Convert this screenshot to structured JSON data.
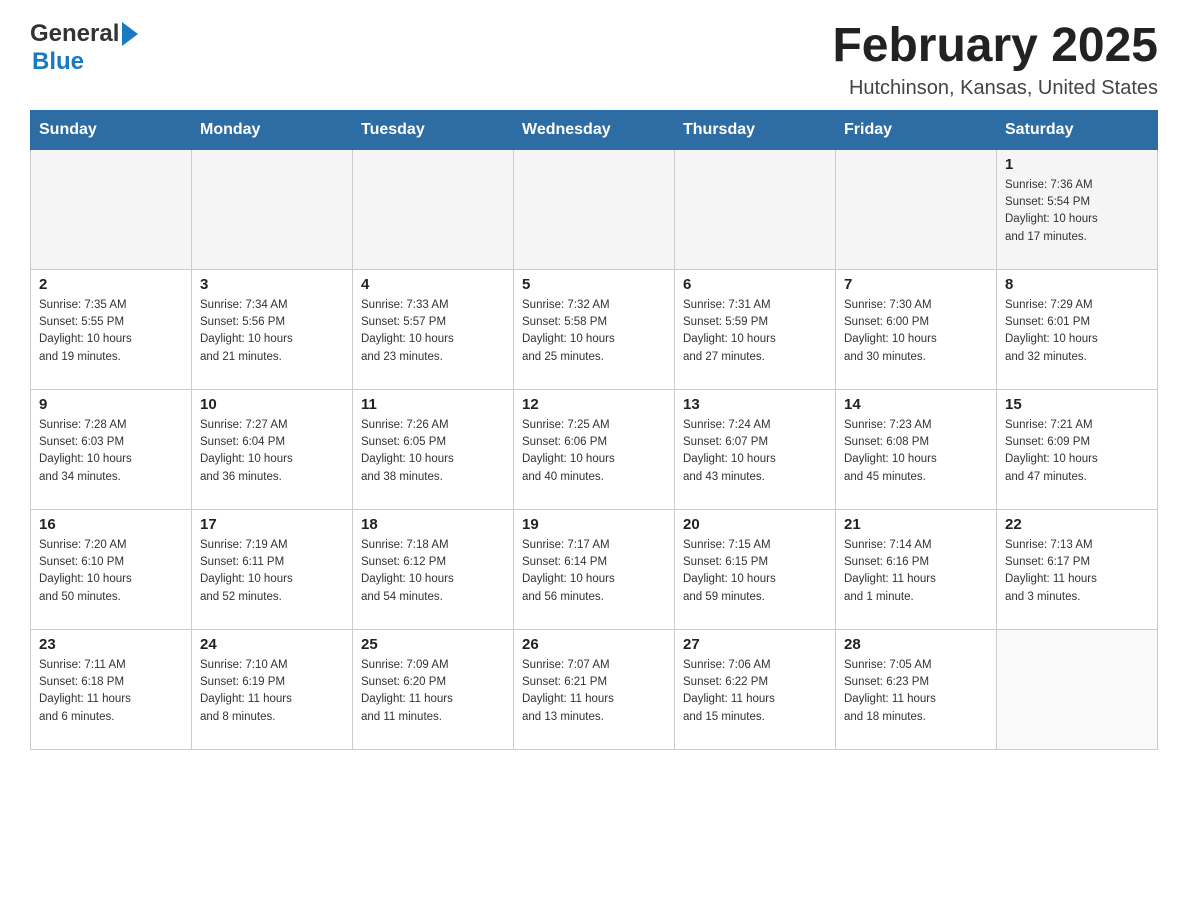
{
  "header": {
    "logo_general": "General",
    "logo_blue": "Blue",
    "month_title": "February 2025",
    "location": "Hutchinson, Kansas, United States"
  },
  "days_of_week": [
    "Sunday",
    "Monday",
    "Tuesday",
    "Wednesday",
    "Thursday",
    "Friday",
    "Saturday"
  ],
  "weeks": [
    {
      "cells": [
        {
          "day": "",
          "info": ""
        },
        {
          "day": "",
          "info": ""
        },
        {
          "day": "",
          "info": ""
        },
        {
          "day": "",
          "info": ""
        },
        {
          "day": "",
          "info": ""
        },
        {
          "day": "",
          "info": ""
        },
        {
          "day": "1",
          "info": "Sunrise: 7:36 AM\nSunset: 5:54 PM\nDaylight: 10 hours\nand 17 minutes."
        }
      ]
    },
    {
      "cells": [
        {
          "day": "2",
          "info": "Sunrise: 7:35 AM\nSunset: 5:55 PM\nDaylight: 10 hours\nand 19 minutes."
        },
        {
          "day": "3",
          "info": "Sunrise: 7:34 AM\nSunset: 5:56 PM\nDaylight: 10 hours\nand 21 minutes."
        },
        {
          "day": "4",
          "info": "Sunrise: 7:33 AM\nSunset: 5:57 PM\nDaylight: 10 hours\nand 23 minutes."
        },
        {
          "day": "5",
          "info": "Sunrise: 7:32 AM\nSunset: 5:58 PM\nDaylight: 10 hours\nand 25 minutes."
        },
        {
          "day": "6",
          "info": "Sunrise: 7:31 AM\nSunset: 5:59 PM\nDaylight: 10 hours\nand 27 minutes."
        },
        {
          "day": "7",
          "info": "Sunrise: 7:30 AM\nSunset: 6:00 PM\nDaylight: 10 hours\nand 30 minutes."
        },
        {
          "day": "8",
          "info": "Sunrise: 7:29 AM\nSunset: 6:01 PM\nDaylight: 10 hours\nand 32 minutes."
        }
      ]
    },
    {
      "cells": [
        {
          "day": "9",
          "info": "Sunrise: 7:28 AM\nSunset: 6:03 PM\nDaylight: 10 hours\nand 34 minutes."
        },
        {
          "day": "10",
          "info": "Sunrise: 7:27 AM\nSunset: 6:04 PM\nDaylight: 10 hours\nand 36 minutes."
        },
        {
          "day": "11",
          "info": "Sunrise: 7:26 AM\nSunset: 6:05 PM\nDaylight: 10 hours\nand 38 minutes."
        },
        {
          "day": "12",
          "info": "Sunrise: 7:25 AM\nSunset: 6:06 PM\nDaylight: 10 hours\nand 40 minutes."
        },
        {
          "day": "13",
          "info": "Sunrise: 7:24 AM\nSunset: 6:07 PM\nDaylight: 10 hours\nand 43 minutes."
        },
        {
          "day": "14",
          "info": "Sunrise: 7:23 AM\nSunset: 6:08 PM\nDaylight: 10 hours\nand 45 minutes."
        },
        {
          "day": "15",
          "info": "Sunrise: 7:21 AM\nSunset: 6:09 PM\nDaylight: 10 hours\nand 47 minutes."
        }
      ]
    },
    {
      "cells": [
        {
          "day": "16",
          "info": "Sunrise: 7:20 AM\nSunset: 6:10 PM\nDaylight: 10 hours\nand 50 minutes."
        },
        {
          "day": "17",
          "info": "Sunrise: 7:19 AM\nSunset: 6:11 PM\nDaylight: 10 hours\nand 52 minutes."
        },
        {
          "day": "18",
          "info": "Sunrise: 7:18 AM\nSunset: 6:12 PM\nDaylight: 10 hours\nand 54 minutes."
        },
        {
          "day": "19",
          "info": "Sunrise: 7:17 AM\nSunset: 6:14 PM\nDaylight: 10 hours\nand 56 minutes."
        },
        {
          "day": "20",
          "info": "Sunrise: 7:15 AM\nSunset: 6:15 PM\nDaylight: 10 hours\nand 59 minutes."
        },
        {
          "day": "21",
          "info": "Sunrise: 7:14 AM\nSunset: 6:16 PM\nDaylight: 11 hours\nand 1 minute."
        },
        {
          "day": "22",
          "info": "Sunrise: 7:13 AM\nSunset: 6:17 PM\nDaylight: 11 hours\nand 3 minutes."
        }
      ]
    },
    {
      "cells": [
        {
          "day": "23",
          "info": "Sunrise: 7:11 AM\nSunset: 6:18 PM\nDaylight: 11 hours\nand 6 minutes."
        },
        {
          "day": "24",
          "info": "Sunrise: 7:10 AM\nSunset: 6:19 PM\nDaylight: 11 hours\nand 8 minutes."
        },
        {
          "day": "25",
          "info": "Sunrise: 7:09 AM\nSunset: 6:20 PM\nDaylight: 11 hours\nand 11 minutes."
        },
        {
          "day": "26",
          "info": "Sunrise: 7:07 AM\nSunset: 6:21 PM\nDaylight: 11 hours\nand 13 minutes."
        },
        {
          "day": "27",
          "info": "Sunrise: 7:06 AM\nSunset: 6:22 PM\nDaylight: 11 hours\nand 15 minutes."
        },
        {
          "day": "28",
          "info": "Sunrise: 7:05 AM\nSunset: 6:23 PM\nDaylight: 11 hours\nand 18 minutes."
        },
        {
          "day": "",
          "info": ""
        }
      ]
    }
  ]
}
